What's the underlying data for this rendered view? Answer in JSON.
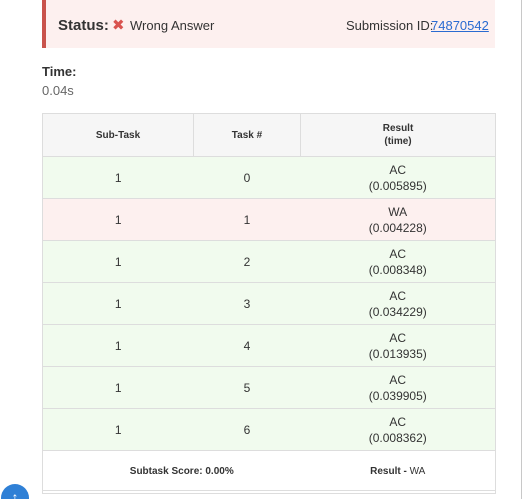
{
  "status": {
    "label": "Status:",
    "icon": "x-icon",
    "value": "Wrong Answer",
    "submission_label": "Submission ID:",
    "submission_id": "74870542"
  },
  "time": {
    "label": "Time:",
    "value": "0.04s"
  },
  "table": {
    "headers": {
      "subtask": "Sub-Task",
      "task": "Task #",
      "result_line1": "Result",
      "result_line2": "(time)"
    },
    "rows": [
      {
        "subtask": "1",
        "task": "0",
        "verdict": "AC",
        "time": "(0.005895)",
        "status": "ac"
      },
      {
        "subtask": "1",
        "task": "1",
        "verdict": "WA",
        "time": "(0.004228)",
        "status": "wa"
      },
      {
        "subtask": "1",
        "task": "2",
        "verdict": "AC",
        "time": "(0.008348)",
        "status": "ac"
      },
      {
        "subtask": "1",
        "task": "3",
        "verdict": "AC",
        "time": "(0.034229)",
        "status": "ac"
      },
      {
        "subtask": "1",
        "task": "4",
        "verdict": "AC",
        "time": "(0.013935)",
        "status": "ac"
      },
      {
        "subtask": "1",
        "task": "5",
        "verdict": "AC",
        "time": "(0.039905)",
        "status": "ac"
      },
      {
        "subtask": "1",
        "task": "6",
        "verdict": "AC",
        "time": "(0.008362)",
        "status": "ac"
      }
    ],
    "footer": {
      "score": "Subtask Score: 0.00%",
      "result_prefix": "Result - ",
      "result_value": "WA"
    }
  },
  "colors": {
    "ac_row": "#f1fbee",
    "wa_row": "#fdf0ef",
    "status_border": "#c9534c",
    "link": "#2a6bd1",
    "fab": "#2f80d6"
  },
  "fab": {
    "icon": "arrow-up-icon",
    "glyph": "↑"
  }
}
